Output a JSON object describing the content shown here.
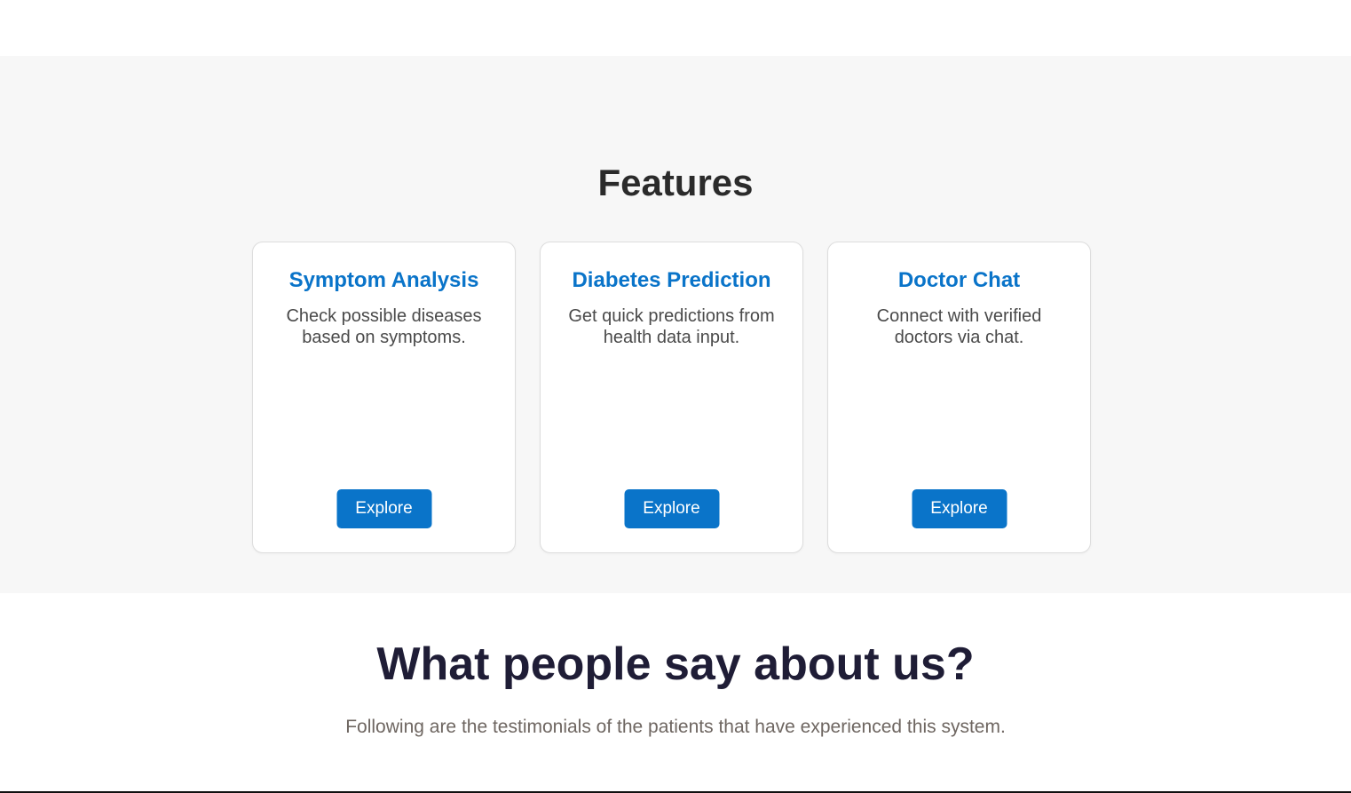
{
  "features": {
    "title": "Features",
    "cards": [
      {
        "title": "Symptom Analysis",
        "description": "Check possible diseases based on symptoms.",
        "button_label": "Explore"
      },
      {
        "title": "Diabetes Prediction",
        "description": "Get quick predictions from health data input.",
        "button_label": "Explore"
      },
      {
        "title": "Doctor Chat",
        "description": "Connect with verified doctors via chat.",
        "button_label": "Explore"
      }
    ]
  },
  "testimonials": {
    "title": "What people say about us?",
    "subtitle": "Following are the testimonials of the patients that have experienced this system."
  },
  "colors": {
    "accent": "#0a74c9",
    "section_bg": "#f7f7f7",
    "heading_dark": "#1f1d36"
  }
}
